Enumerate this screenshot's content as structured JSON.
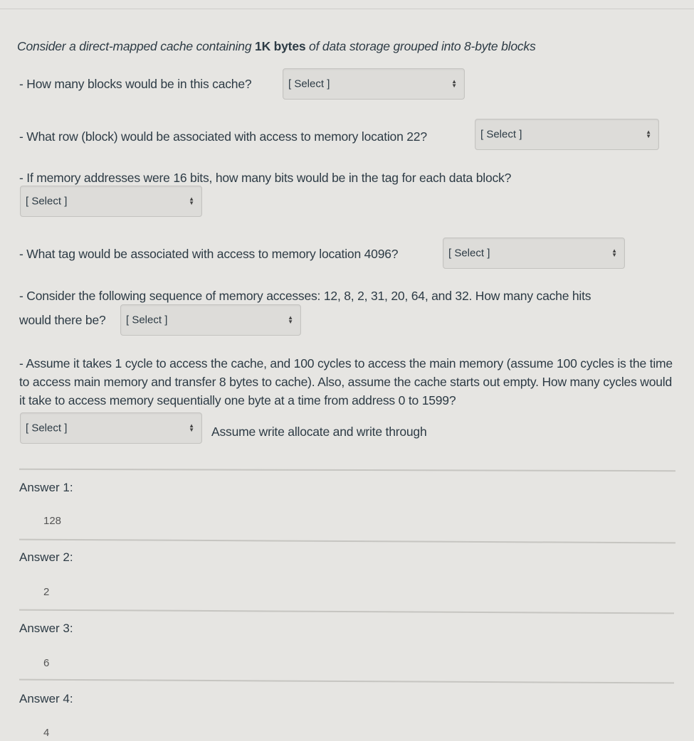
{
  "intro": {
    "prefix": "Consider a direct-mapped cache containing ",
    "bold1": "1K bytes",
    "suffix": " of data storage grouped into 8-byte blocks"
  },
  "questions": [
    {
      "text": "- How many blocks would be in this cache?",
      "select": "[ Select ]"
    },
    {
      "text": "- What row (block) would be associated with access to memory location 22?",
      "select": "[ Select ]"
    },
    {
      "text": "- If memory addresses were 16 bits, how many bits would be in the tag for each data block?",
      "select": "[ Select ]"
    },
    {
      "text": "- What tag would be associated with access to memory location 4096?",
      "select": "[ Select ]"
    },
    {
      "text_line1": "- Consider the following sequence of memory accesses: 12, 8, 2, 31, 20, 64, and 32. How many cache hits",
      "text_line2": "would there be?",
      "select": "[ Select ]"
    },
    {
      "text": "- Assume it takes 1 cycle to access the cache, and 100 cycles to access the main memory (assume 100 cycles is the time to access main memory and transfer 8 bytes to cache). Also, assume the cache starts out empty. How many cycles would it take to access memory sequentially one byte at a time from address 0 to 1599?",
      "select": "[ Select ]",
      "note": "Assume write allocate and write through"
    }
  ],
  "answers": [
    {
      "title": "Answer 1:",
      "value": "128"
    },
    {
      "title": "Answer 2:",
      "value": "2"
    },
    {
      "title": "Answer 3:",
      "value": "6"
    },
    {
      "title": "Answer 4:",
      "value": "4"
    }
  ]
}
